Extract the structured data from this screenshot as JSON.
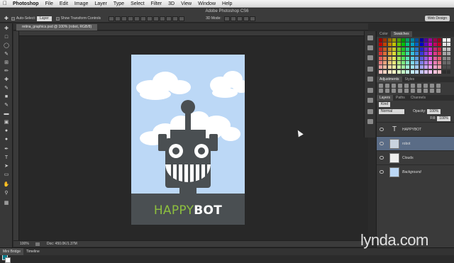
{
  "menubar": {
    "app": "Photoshop",
    "menus": [
      "File",
      "Edit",
      "Image",
      "Layer",
      "Type",
      "Select",
      "Filter",
      "3D",
      "View",
      "Window",
      "Help"
    ]
  },
  "window": {
    "title": "Adobe Photoshop CS6"
  },
  "options": {
    "auto_select_label": "Auto-Select:",
    "auto_select_value": "Layer",
    "transform_label": "Show Transform Controls",
    "mode_label": "3D Mode:",
    "workspace": "Web Design"
  },
  "document": {
    "tab": "retina_graphics.psd @ 100% (robot, RGB/8)",
    "brand_left": "HAPPY",
    "brand_right": "BOT",
    "zoom": "100%",
    "doc_info": "Doc: 450.0K/1.37M"
  },
  "panels": {
    "color_tab": "Color",
    "swatches_tab": "Swatches",
    "adjustments_tab": "Adjustments",
    "styles_tab": "Styles",
    "layers_tab": "Layers",
    "paths_tab": "Paths",
    "channels_tab": "Channels",
    "kind_label": "Kind",
    "blend_mode": "Normal",
    "opacity_label": "Opacity:",
    "opacity_value": "100%",
    "fill_label": "Fill:",
    "fill_value": "100%",
    "layers": [
      {
        "name": "HAPPYBOT",
        "kind": "text",
        "selected": false
      },
      {
        "name": "robot",
        "kind": "image",
        "selected": true
      },
      {
        "name": "Clouds",
        "kind": "image",
        "selected": false
      },
      {
        "name": "Background",
        "kind": "fill",
        "selected": false
      }
    ]
  },
  "bottom": {
    "tab1": "Mini Bridge",
    "tab2": "Timeline"
  },
  "watermark": "lynda.com",
  "colors": {
    "sky": "#bcd8f6",
    "robot": "#4a4f52",
    "happy_green": "#8dbf3f",
    "bot_white": "#ffffff",
    "selection": "#5a6c86"
  }
}
